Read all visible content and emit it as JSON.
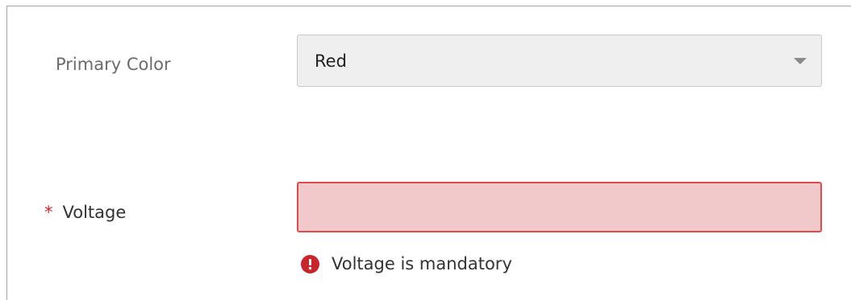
{
  "form": {
    "primary_color": {
      "label": "Primary Color",
      "selected_value": "Red",
      "icon": "chevron-down-icon"
    },
    "voltage": {
      "required_marker": "*",
      "label": "Voltage",
      "value": "",
      "error_message": "Voltage is mandatory",
      "error_icon": "error-icon"
    }
  },
  "colors": {
    "error_red": "#c9262c",
    "error_background": "#f2c9cb",
    "error_border": "#dd4b4f",
    "select_background": "#efefef"
  }
}
